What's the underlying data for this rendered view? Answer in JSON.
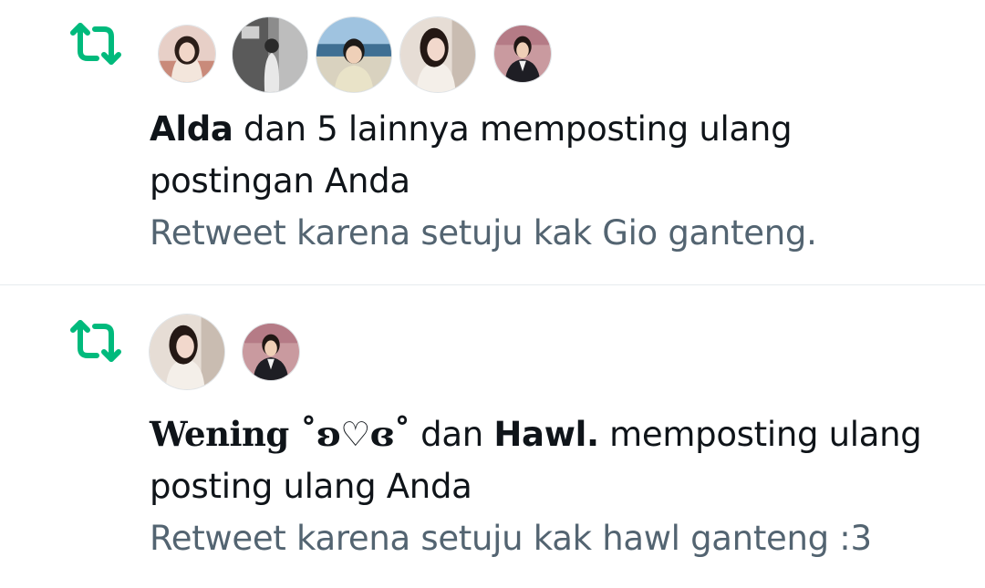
{
  "colors": {
    "retweet_green": "#00ba7c",
    "text_primary": "#0f1419",
    "text_secondary": "#536471",
    "divider": "#e6ebee"
  },
  "notifications": [
    {
      "icon": "retweet-icon",
      "avatars": [
        {
          "icon": "avatar-photo"
        },
        {
          "icon": "avatar-photo"
        },
        {
          "icon": "avatar-photo"
        },
        {
          "icon": "avatar-photo"
        },
        {
          "icon": "avatar-photo"
        }
      ],
      "actor": "Alda",
      "headline_rest_line1": " dan 5 lainnya memposting ulang",
      "headline_line2": "postingan Anda",
      "quote": "Retweet karena setuju kak Gio ganteng."
    },
    {
      "icon": "retweet-icon",
      "avatars": [
        {
          "icon": "avatar-photo"
        },
        {
          "icon": "avatar-photo"
        }
      ],
      "actor1": "Wening ˚ʚ♡ɞ˚",
      "connector": " dan ",
      "actor2": "Hawl.",
      "headline_rest_line1": " memposting ulang",
      "headline_line2": "posting ulang Anda",
      "quote": "Retweet karena setuju kak hawl ganteng :3"
    }
  ]
}
